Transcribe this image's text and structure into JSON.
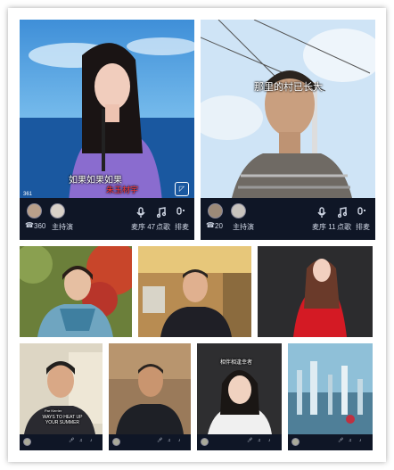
{
  "top_left": {
    "caption": "如果如果如果",
    "caption_red": "朱玉材宇",
    "counter": "361",
    "viewers": "360",
    "host_label": "主持演",
    "actions": [
      "麦序 47",
      "点歌",
      "排麦"
    ]
  },
  "top_right": {
    "caption": "那里的村已长大",
    "viewers": "20",
    "host_label": "主持演",
    "actions": [
      "麦序 11",
      "点歌",
      "排麦"
    ]
  },
  "bottom_tiles": [
    {
      "caption": "WAYS TO HEAT UP YOUR SUMMER",
      "subcaption": "Par Kerrier"
    },
    {
      "caption": ""
    },
    {
      "caption": "相伴相逢幸者"
    },
    {
      "caption": ""
    }
  ],
  "colors": {
    "bar": "#0f1626",
    "icon": "#cfd6e4",
    "red": "#e0202a"
  },
  "icons": [
    "mic-icon",
    "music-note-icon",
    "mic-queue-icon",
    "phone-icon",
    "camera-icon"
  ]
}
